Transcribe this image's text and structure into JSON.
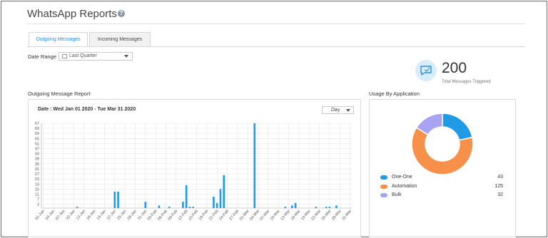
{
  "header": {
    "title": "WhatsApp Reports",
    "help_icon": "?"
  },
  "tabs": [
    {
      "label": "Outgoing Messages",
      "active": true
    },
    {
      "label": "Incoming Messages",
      "active": false
    }
  ],
  "filters": {
    "date_range_label": "Date Range",
    "date_range_value": "Last Quarter"
  },
  "kpi": {
    "value": "200",
    "label": "Total Messages Triggered",
    "icon": "message-icon"
  },
  "report": {
    "title": "Outgoing Message Report",
    "date_label": "Date : Wed Jan 01 2020 - Tue Mar 31 2020",
    "granularity": "Day"
  },
  "usage": {
    "title": "Usage By Application"
  },
  "colors": {
    "accent": "#2b8fd6",
    "bar": "#1f9be6",
    "one_one": "#1f9be6",
    "automation": "#f7914a",
    "bulk": "#a9a3f3"
  },
  "chart_data": [
    {
      "type": "bar",
      "ylim": [
        0,
        67
      ],
      "yticks": [
        "67",
        "63",
        "59",
        "55",
        "51",
        "47",
        "43",
        "39",
        "35",
        "31",
        "27",
        "23",
        "19",
        "15",
        "11",
        "7",
        "3"
      ],
      "categories": [
        "01-Jan",
        "04-Jan",
        "07-Jan",
        "10-Jan",
        "13-Jan",
        "16-Jan",
        "19-Jan",
        "22-Jan",
        "25-Jan",
        "28-Jan",
        "31-Jan",
        "03-Feb",
        "06-Feb",
        "09-Feb",
        "12-Feb",
        "15-Feb",
        "18-Feb",
        "21-Feb",
        "24-Feb",
        "27-Feb",
        "01-Mar",
        "04-Mar",
        "07-Mar",
        "10-Mar",
        "13-Mar",
        "16-Mar",
        "19-Mar",
        "22-Mar",
        "25-Mar",
        "28-Mar",
        "31-Mar"
      ],
      "bars": [
        {
          "day": 10,
          "value": 1
        },
        {
          "day": 21,
          "value": 13
        },
        {
          "day": 22,
          "value": 13
        },
        {
          "day": 30,
          "value": 5
        },
        {
          "day": 34,
          "value": 2
        },
        {
          "day": 37,
          "value": 1
        },
        {
          "day": 41,
          "value": 5
        },
        {
          "day": 42,
          "value": 18
        },
        {
          "day": 43,
          "value": 1
        },
        {
          "day": 44,
          "value": 1
        },
        {
          "day": 50,
          "value": 9
        },
        {
          "day": 51,
          "value": 4
        },
        {
          "day": 52,
          "value": 15
        },
        {
          "day": 53,
          "value": 26
        },
        {
          "day": 62,
          "value": 67
        },
        {
          "day": 71,
          "value": 1
        },
        {
          "day": 73,
          "value": 2
        },
        {
          "day": 74,
          "value": 4
        },
        {
          "day": 80,
          "value": 1
        },
        {
          "day": 83,
          "value": 1
        },
        {
          "day": 84,
          "value": 1
        },
        {
          "day": 86,
          "value": 2
        },
        {
          "day": 97,
          "value": 3
        },
        {
          "day": 113,
          "value": 1
        },
        {
          "day": 115,
          "value": 7
        },
        {
          "day": 116,
          "value": 1
        }
      ]
    },
    {
      "type": "pie",
      "donut": true,
      "slices": [
        {
          "label": "One-One",
          "value": 43
        },
        {
          "label": "Automation",
          "value": 125
        },
        {
          "label": "Bulk",
          "value": 32
        }
      ]
    }
  ]
}
